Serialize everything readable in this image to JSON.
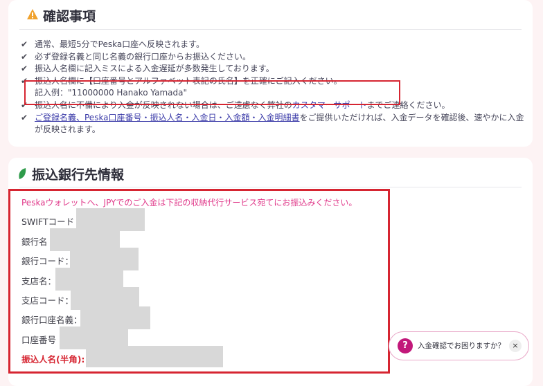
{
  "confirm": {
    "title": "確認事項",
    "icon": "warning-icon",
    "items": [
      {
        "text": "通常、最短5分でPeska口座へ反映されます。"
      },
      {
        "text": "必ず登録名義と同じ名義の銀行口座からお振込ください。"
      },
      {
        "text": "振込人名欄に記入ミスによる入金遅延が多数発生しております。"
      },
      {
        "text": "振込人名欄に【口座番号とアルファベット表記の氏名】を正確にご記入ください。",
        "sub": "記入例：\"11000000 Hanako Yamada\""
      },
      {
        "pre": "振込人名に不備により入金が反映されない場合は、ご遠慮なく弊社の",
        "link": "カスタマーサポート",
        "post": "までご連絡ください。"
      },
      {
        "link": "ご登録名義、Peska口座番号・振込人名・入金日・入金額・入金明細書",
        "post": "をご提供いただければ、入金データを確認後、速やかに入金が反映されます。"
      }
    ]
  },
  "bank": {
    "title": "振込銀行先情報",
    "icon": "leaf-icon",
    "note": "Peskaウォレットへ、JPYでのご入金は下記の収納代行サービス宛てにお振込みください。",
    "fields": [
      {
        "label": "SWIFTコード"
      },
      {
        "label": "銀行名"
      },
      {
        "label": "銀行コード："
      },
      {
        "label": "支店名："
      },
      {
        "label": "支店コード："
      },
      {
        "label": "銀行口座名義："
      },
      {
        "label": "口座番号"
      },
      {
        "label": "振込人名(半角):"
      }
    ]
  },
  "chat": {
    "text": "入金確認でお困りますか？",
    "icon": "help-icon",
    "close": "×"
  },
  "colors": {
    "highlight": "#d62531",
    "note": "#e0398a",
    "link": "#3a3aa8"
  }
}
